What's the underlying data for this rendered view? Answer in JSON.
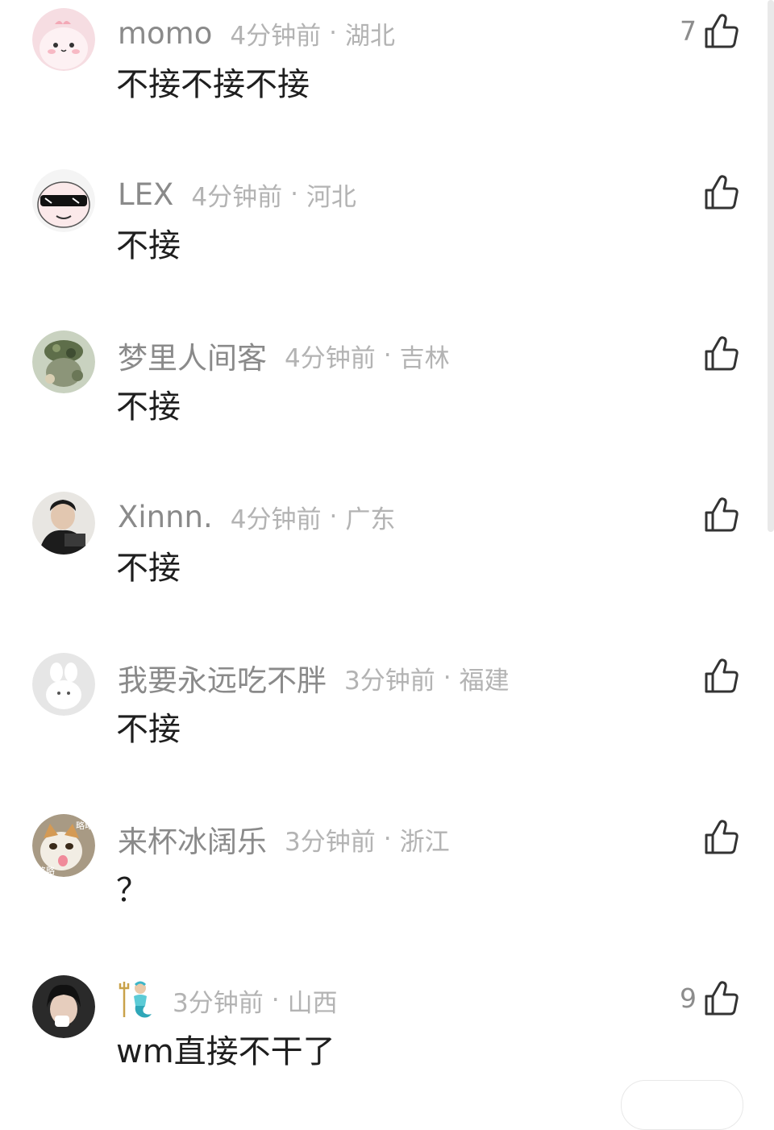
{
  "comments": [
    {
      "username": "momo",
      "time": "4分钟前",
      "sep": "·",
      "region": "湖北",
      "text": "不接不接不接",
      "likes": "7"
    },
    {
      "username": "LEX",
      "time": "4分钟前",
      "sep": "·",
      "region": "河北",
      "text": "不接",
      "likes": ""
    },
    {
      "username": "梦里人间客",
      "time": "4分钟前",
      "sep": "·",
      "region": "吉林",
      "text": "不接",
      "likes": ""
    },
    {
      "username": "Xinnn.",
      "time": "4分钟前",
      "sep": "·",
      "region": "广东",
      "text": "不接",
      "likes": ""
    },
    {
      "username": "我要永远吃不胖",
      "time": "3分钟前",
      "sep": "·",
      "region": "福建",
      "text": "不接",
      "likes": ""
    },
    {
      "username": "来杯冰阔乐",
      "time": "3分钟前",
      "sep": "·",
      "region": "浙江",
      "text": "？",
      "likes": ""
    },
    {
      "username": "",
      "time": "3分钟前",
      "sep": "·",
      "region": "山西",
      "text": "wm直接不干了",
      "likes": "9"
    }
  ],
  "avatar_texts": {
    "cat": "略略"
  }
}
